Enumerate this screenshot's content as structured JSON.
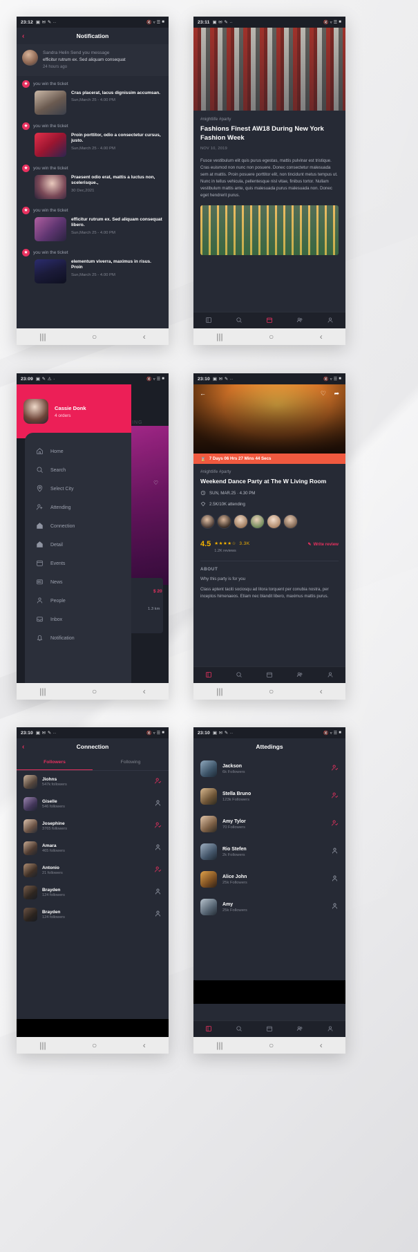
{
  "screens": {
    "notification": {
      "statusbar": {
        "time": "23:12"
      },
      "header": {
        "title": "Notification",
        "back": "‹"
      },
      "message": {
        "name": "Sandra Helin",
        "action": "Send you message",
        "body": "efficitur rutrum ex. Sed aliquam consequat",
        "time": "24 hours ago"
      },
      "win_label": "you win the ticket",
      "items": [
        {
          "title": "Cras placerat, lacus dignissim accumsan.",
          "date": "Sun,March 25 - 4.00 PM"
        },
        {
          "title": "Proin porttitor, odio a consectetur cursus, justo.",
          "date": "Sun,March 25 - 4.00 PM"
        },
        {
          "title": "Praesent odio erat, mattis a luctus non, scelerisque.,",
          "date": "30 Dec,2021"
        },
        {
          "title": "efficitur rutrum ex. Sed aliquam consequat libero.",
          "date": "Sun,March 25 - 4.00 PM"
        },
        {
          "title": "elementum viverra, maximus in risus. Proin",
          "date": "Sun,March 25 - 4.00 PM"
        }
      ]
    },
    "article": {
      "statusbar": {
        "time": "23:11"
      },
      "tags": "#nightlife #party",
      "title": "Fashions Finest AW18 During New York Fashion Week",
      "date": "NOV 10, 2019",
      "body": "Fusce vestibulum elit quis purus egestas, mattis pulvinar est tristique. Cras euismod non nunc non posuere. Donec consectetur malesuada sem at mattis. Proin posuere porttitor elit, non tincidunt metus tempus ut. Nunc in tellus vehicula, pellentesque nisl vitae, finibus tortor. Nullam vestibulum mattis ante, quis malesuada purus malesuada non. Donec eget hendrerit purus."
    },
    "drawer": {
      "statusbar": {
        "time": "23:09"
      },
      "user": {
        "name": "Cassie Donk",
        "orders": "4 orders"
      },
      "behind": {
        "label": "TRENDING",
        "price": "$ 20",
        "distance": "1.3 km"
      },
      "items": [
        {
          "label": "Home",
          "icon": "home-icon"
        },
        {
          "label": "Search",
          "icon": "search-icon"
        },
        {
          "label": "Select City",
          "icon": "location-pin-icon"
        },
        {
          "label": "Attending",
          "icon": "user-plus-icon"
        },
        {
          "label": "Connection",
          "icon": "home-alt-icon"
        },
        {
          "label": "Detail",
          "icon": "home-alt-icon"
        },
        {
          "label": "Events",
          "icon": "calendar-icon"
        },
        {
          "label": "News",
          "icon": "news-icon"
        },
        {
          "label": "People",
          "icon": "person-icon"
        },
        {
          "label": "Inbox",
          "icon": "inbox-icon"
        },
        {
          "label": "Notification",
          "icon": "bell-icon"
        }
      ]
    },
    "event": {
      "statusbar": {
        "time": "23:10"
      },
      "countdown": "7 Days 06 Hrs 27 Mins 44 Secs",
      "tags": "#nightlife #party",
      "title": "Weekend Dance Party at The W Living Room",
      "when": "SUN, MAR.25 · 4.30 PM",
      "attending": "2.5K/10K attending",
      "rating": "4.5",
      "stars": "★★★★☆",
      "rating_count": "3.3K",
      "reviews": "1.2K reviews",
      "write_review": "Write review",
      "about_heading": "ABOUT",
      "about_line1": "Why this party is for you",
      "about_body": "Class aptent taciti sociosqu ad litora torquent per conubia nostra, per inceptos himenaeos. Etiam nec blandit libero, maximus mattis purus."
    },
    "connection": {
      "statusbar": {
        "time": "23:10"
      },
      "header": {
        "title": "Connection",
        "back": "‹"
      },
      "tabs": [
        {
          "label": "Followers",
          "active": true
        },
        {
          "label": "Following",
          "active": false
        }
      ],
      "rows": [
        {
          "name": "Jiohns",
          "sub": "547k followers",
          "action": "added"
        },
        {
          "name": "Giselle",
          "sub": "546 followers",
          "action": "plain"
        },
        {
          "name": "Josephine",
          "sub": "3765 followers",
          "action": "added"
        },
        {
          "name": "Amara",
          "sub": "465 followers",
          "action": "plain"
        },
        {
          "name": "Antonio",
          "sub": "21 followers",
          "action": "added"
        },
        {
          "name": "Brayden",
          "sub": "124 followers",
          "action": "plain"
        },
        {
          "name": "Brayden",
          "sub": "124 followers",
          "action": "plain"
        }
      ]
    },
    "attendings": {
      "statusbar": {
        "time": "23:10"
      },
      "header": {
        "title": "Attedings"
      },
      "rows": [
        {
          "name": "Jackson",
          "sub": "6k Followers",
          "action": "added"
        },
        {
          "name": "Stella Bruno",
          "sub": "123k Followers",
          "action": "added"
        },
        {
          "name": "Amy Tylor",
          "sub": "70 Followers",
          "action": "added"
        },
        {
          "name": "Rio Stefen",
          "sub": "2k Followers",
          "action": "plain"
        },
        {
          "name": "Alice John",
          "sub": "25k Followers",
          "action": "plain"
        },
        {
          "name": "Amy",
          "sub": "25k Followers",
          "action": "plain"
        }
      ]
    }
  },
  "sysnav": {
    "recents": "|||",
    "home": "○",
    "back": "‹"
  },
  "colors": {
    "accent": "#e8315f",
    "drawer_pink": "#ec1f57",
    "countdown": "#f0593f",
    "star": "#f5b301"
  }
}
